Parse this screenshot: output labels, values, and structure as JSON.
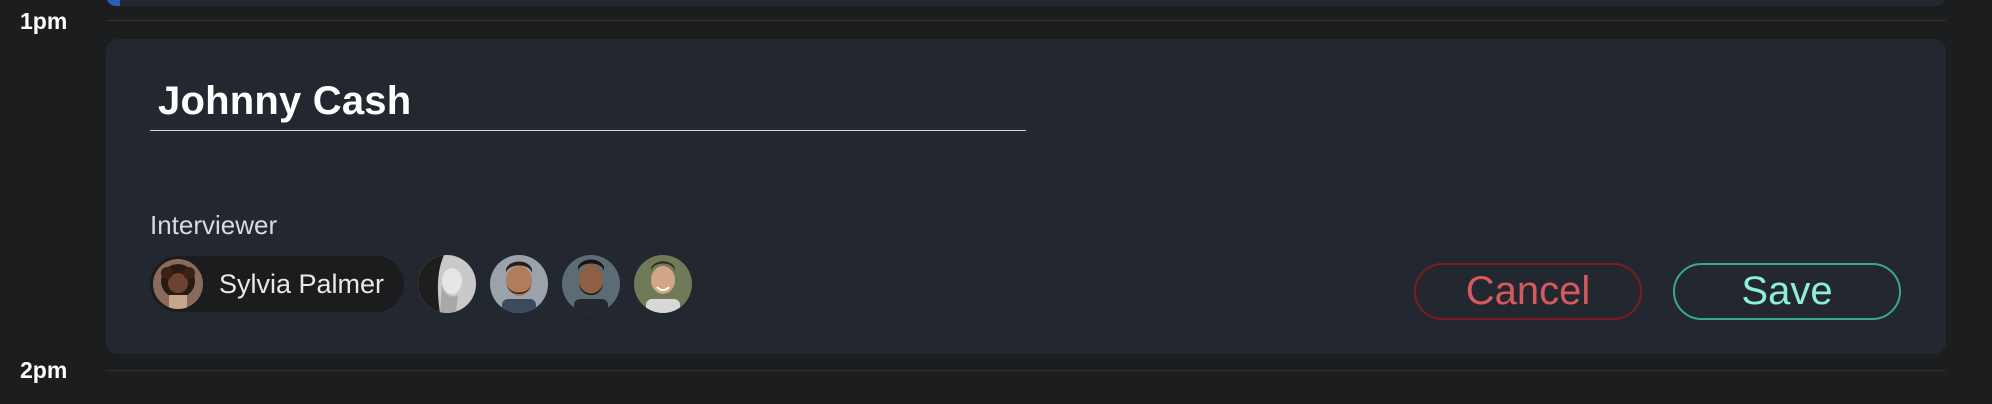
{
  "timeline": {
    "labels": [
      "1pm",
      "2pm"
    ]
  },
  "event": {
    "title": "Johnny Cash",
    "interviewer_label": "Interviewer",
    "selected_interviewer": {
      "name": "Sylvia Palmer",
      "avatar_icon": "avatar-sylvia-palmer"
    },
    "other_interviewers": [
      {
        "avatar_icon": "avatar-woman-bw"
      },
      {
        "avatar_icon": "avatar-man-beard-1"
      },
      {
        "avatar_icon": "avatar-man-beard-2"
      },
      {
        "avatar_icon": "avatar-man-smiling"
      }
    ],
    "actions": {
      "cancel_label": "Cancel",
      "save_label": "Save"
    }
  },
  "colors": {
    "background": "#1b1d1e",
    "card": "#232830",
    "cancel": "#d45a5e",
    "cancel_border": "#7a1c22",
    "save": "#8ef0d2",
    "save_border": "#3aa88a",
    "previous_event_accent": "#2b5cb8"
  }
}
